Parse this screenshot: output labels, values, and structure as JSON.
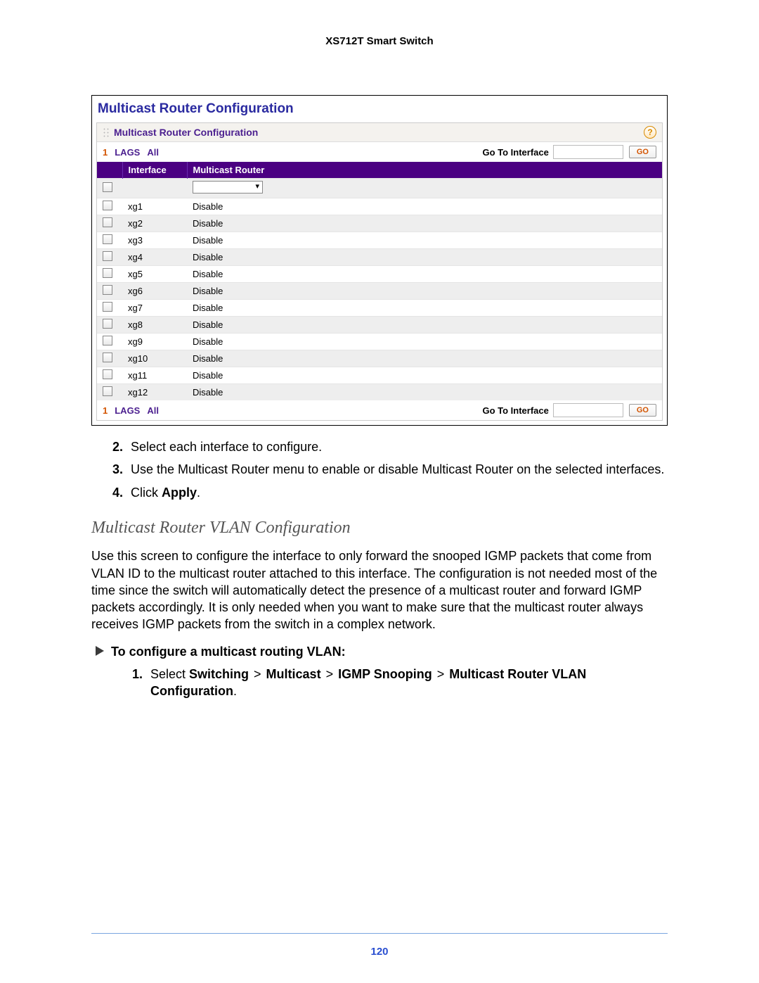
{
  "device_header": "XS712T Smart Switch",
  "panel": {
    "title": "Multicast Router Configuration",
    "inner_title": "Multicast Router Configuration",
    "help_glyph": "?",
    "tabs": {
      "one": "1",
      "lags": "LAGS",
      "all": "All"
    },
    "goto_label": "Go To Interface",
    "go_button": "GO",
    "columns": {
      "interface": "Interface",
      "mrouter": "Multicast Router"
    },
    "rows": [
      {
        "intf": "xg1",
        "val": "Disable"
      },
      {
        "intf": "xg2",
        "val": "Disable"
      },
      {
        "intf": "xg3",
        "val": "Disable"
      },
      {
        "intf": "xg4",
        "val": "Disable"
      },
      {
        "intf": "xg5",
        "val": "Disable"
      },
      {
        "intf": "xg6",
        "val": "Disable"
      },
      {
        "intf": "xg7",
        "val": "Disable"
      },
      {
        "intf": "xg8",
        "val": "Disable"
      },
      {
        "intf": "xg9",
        "val": "Disable"
      },
      {
        "intf": "xg10",
        "val": "Disable"
      },
      {
        "intf": "xg11",
        "val": "Disable"
      },
      {
        "intf": "xg12",
        "val": "Disable"
      }
    ]
  },
  "steps_cont": [
    {
      "n": "2.",
      "t": "Select each interface to configure."
    },
    {
      "n": "3.",
      "t": "Use the Multicast Router menu to enable or disable Multicast Router on the selected interfaces."
    },
    {
      "n": "4.",
      "pre": "Click ",
      "bold": "Apply",
      "post": "."
    }
  ],
  "section_heading": "Multicast Router VLAN Configuration",
  "section_para": "Use this screen to configure the interface to only forward the snooped IGMP packets that come from VLAN ID to the multicast router attached to this interface. The configuration is not needed most of the time since the switch will automatically detect the presence of a multicast router and forward IGMP packets accordingly. It is only needed when you want to make sure that the multicast router always receives IGMP packets from the switch in a complex network.",
  "proc_heading": "To configure a multicast routing VLAN:",
  "proc_step": {
    "n": "1.",
    "pre": "Select ",
    "crumbs": [
      "Switching",
      "Multicast",
      "IGMP Snooping",
      "Multicast Router VLAN Configuration"
    ],
    "sep": ">",
    "post": "."
  },
  "page_number": "120"
}
